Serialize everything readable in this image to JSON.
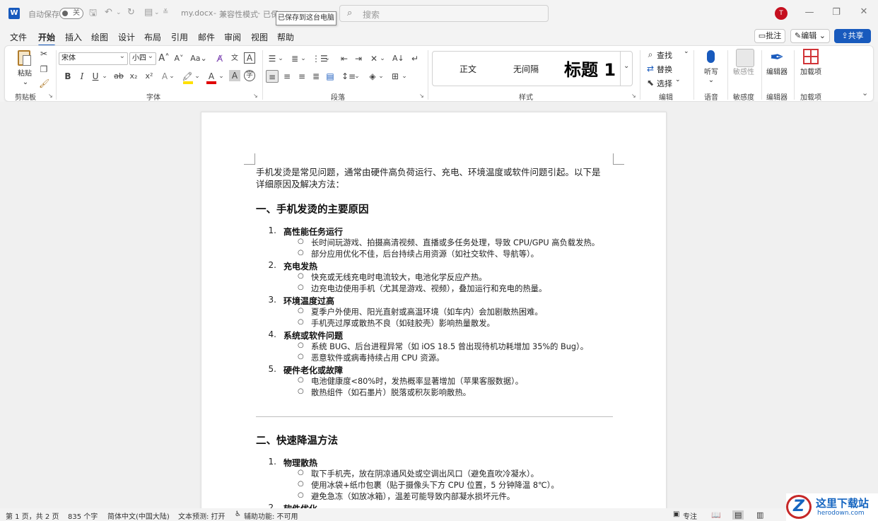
{
  "titlebar": {
    "app_icon": "word-icon",
    "autosave_label": "自动保存",
    "autosave_state": "关",
    "filename": "my.docx",
    "mode": "兼容性模式",
    "status_partial": "已保",
    "tooltip": "已保存到这台电脑",
    "search_placeholder": "搜索",
    "user_initial": "T"
  },
  "menu": {
    "items": [
      "文件",
      "开始",
      "插入",
      "绘图",
      "设计",
      "布局",
      "引用",
      "邮件",
      "审阅",
      "视图",
      "帮助"
    ],
    "active": "开始",
    "comment_btn": "批注",
    "edit_btn": "编辑",
    "share_btn": "共享"
  },
  "ribbon": {
    "clipboard": {
      "paste": "粘贴",
      "label": "剪贴板"
    },
    "font": {
      "name": "宋体",
      "size": "小四",
      "label": "字体"
    },
    "paragraph": {
      "label": "段落"
    },
    "styles": {
      "items": [
        "正文",
        "无间隔",
        "标题 1"
      ],
      "label": "样式"
    },
    "editing": {
      "find": "查找",
      "replace": "替换",
      "select": "选择",
      "label": "编辑"
    },
    "voice": {
      "dictate": "听写",
      "label": "语音"
    },
    "sensitivity": {
      "btn": "敏感性",
      "label": "敏感度"
    },
    "editor": {
      "btn": "编辑器",
      "label": "编辑器"
    },
    "addins": {
      "btn": "加载项",
      "label": "加载项"
    },
    "colors": {
      "highlight": "#ffe000",
      "font_color": "#e00000",
      "accent": "#185abd"
    }
  },
  "document": {
    "intro_line1": "手机发烫是常见问题，通常由硬件高负荷运行、充电、环境温度或软件问题引起。以下是",
    "intro_line2": "详细原因及解决方法：",
    "section1": {
      "heading": "一、手机发烫的主要原因",
      "items": [
        {
          "num": "1.",
          "title": "高性能任务运行",
          "bullets": [
            "长时间玩游戏、拍摄高清视频、直播或多任务处理，导致 CPU/GPU 高负载发热。",
            "部分应用优化不佳，后台持续占用资源（如社交软件、导航等）。"
          ]
        },
        {
          "num": "2.",
          "title": "充电发热",
          "bullets": [
            "快充或无线充电时电流较大，电池化学反应产热。",
            "边充电边使用手机（尤其是游戏、视频），叠加运行和充电的热量。"
          ]
        },
        {
          "num": "3.",
          "title": "环境温度过高",
          "bullets": [
            "夏季户外使用、阳光直射或高温环境（如车内）会加剧散热困难。",
            "手机壳过厚或散热不良（如硅胶壳）影响热量散发。"
          ]
        },
        {
          "num": "4.",
          "title": "系统或软件问题",
          "bullets": [
            "系统 BUG、后台进程异常（如 iOS 18.5 曾出现待机功耗增加 35%的 Bug）。",
            "恶意软件或病毒持续占用 CPU 资源。"
          ]
        },
        {
          "num": "5.",
          "title": "硬件老化或故障",
          "bullets": [
            "电池健康度<80%时，发热概率显著增加（苹果客服数据）。",
            "散热组件（如石墨片）脱落或积灰影响散热。"
          ]
        }
      ]
    },
    "section2": {
      "heading": "二、快速降温方法",
      "items": [
        {
          "num": "1.",
          "title": "物理散热",
          "bullets": [
            "取下手机壳，放在阴凉通风处或空调出风口（避免直吹冷凝水）。",
            "使用冰袋+纸巾包裹（贴于摄像头下方 CPU 位置，5 分钟降温 8℃）。",
            "避免急冻（如放冰箱），温差可能导致内部凝水损坏元件。"
          ]
        },
        {
          "num": "2.",
          "title": "软件优化"
        }
      ]
    }
  },
  "statusbar": {
    "page": "第 1 页，共 2 页",
    "words": "835 个字",
    "language": "简体中文(中国大陆)",
    "prediction": "文本预测: 打开",
    "accessibility": "辅助功能: 不可用",
    "focus": "专注"
  },
  "watermark": {
    "logo": "Z",
    "cn": "这里下载站",
    "en": "herodown.com"
  }
}
